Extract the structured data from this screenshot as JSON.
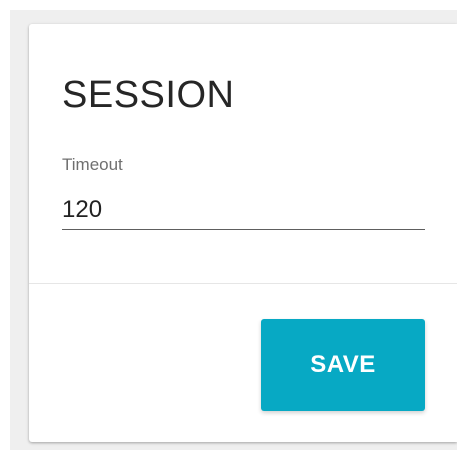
{
  "card": {
    "title": "SESSION"
  },
  "timeout_field": {
    "label": "Timeout",
    "value": "120"
  },
  "actions": {
    "save_label": "SAVE"
  },
  "colors": {
    "accent": "#07a9c4",
    "background": "#efefef",
    "card": "#ffffff",
    "title_text": "#262626",
    "label_text": "#6f6f6f"
  }
}
